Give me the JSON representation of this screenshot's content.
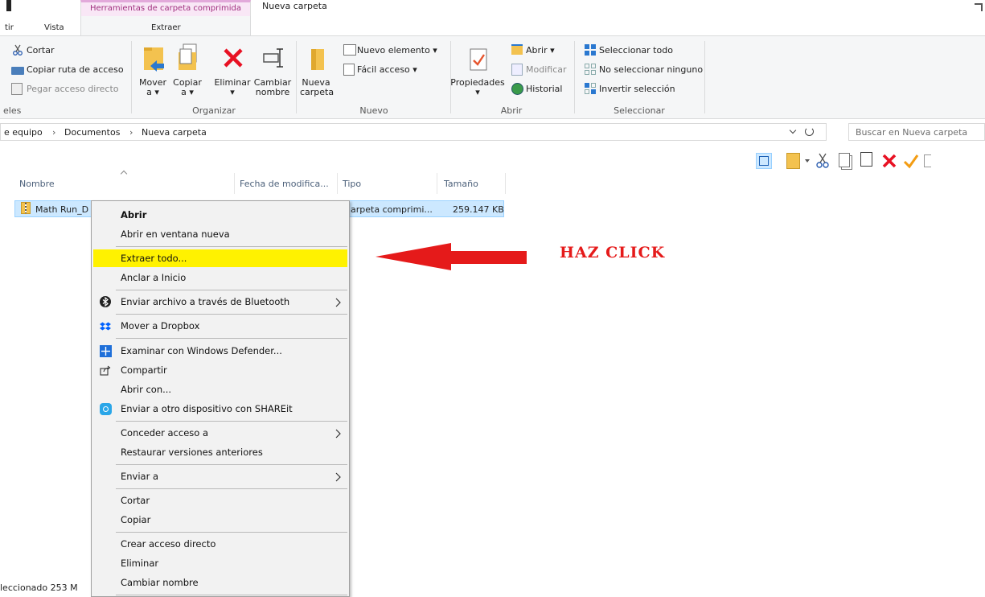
{
  "window": {
    "context_tab": "Herramientas de carpeta comprimida",
    "title": "Nueva carpeta"
  },
  "tabs": {
    "left_partial": "tir",
    "vista": "Vista",
    "extraer": "Extraer"
  },
  "ribbon": {
    "portapapeles": {
      "cortar": "Cortar",
      "copiar_ruta": "Copiar ruta de acceso",
      "pegar_acceso": "Pegar acceso directo",
      "group_partial": "eles"
    },
    "organizar": {
      "mover": [
        "Mover",
        "a ▾"
      ],
      "copiar": [
        "Copiar",
        "a ▾"
      ],
      "eliminar": [
        "Eliminar",
        "▾"
      ],
      "cambiar": [
        "Cambiar",
        "nombre"
      ],
      "group": "Organizar"
    },
    "nuevo": {
      "nueva_carpeta": [
        "Nueva",
        "carpeta"
      ],
      "nuevo_elemento": "Nuevo elemento ▾",
      "facil_acceso": "Fácil acceso ▾",
      "group": "Nuevo"
    },
    "abrir": {
      "propiedades": [
        "Propiedades",
        "▾"
      ],
      "abrir": "Abrir ▾",
      "modificar": "Modificar",
      "historial": "Historial",
      "group": "Abrir"
    },
    "seleccionar": {
      "todo": "Seleccionar todo",
      "ninguno": "No seleccionar ninguno",
      "invertir": "Invertir selección",
      "group": "Seleccionar"
    }
  },
  "address": {
    "crumbs": [
      "e equipo",
      "›",
      "Documentos",
      "›",
      "Nueva carpeta"
    ],
    "search_placeholder": "Buscar en Nueva carpeta"
  },
  "columns": [
    "Nombre",
    "Fecha de modifica...",
    "Tipo",
    "Tamaño"
  ],
  "file": {
    "name": "Math Run_D",
    "type": "arpeta comprimi...",
    "size": "259.147 KB"
  },
  "context_menu": {
    "abrir": "Abrir",
    "abrir_ventana": "Abrir en ventana nueva",
    "extraer_todo": "Extraer todo...",
    "anclar": "Anclar a Inicio",
    "bluetooth": "Enviar archivo a través de Bluetooth",
    "dropbox": "Mover a Dropbox",
    "defender": "Examinar con Windows Defender...",
    "compartir": "Compartir",
    "abrir_con": "Abrir con...",
    "shareit": "Enviar a otro dispositivo con SHAREit",
    "conceder": "Conceder acceso a",
    "restaurar": "Restaurar versiones anteriores",
    "enviar_a": "Enviar a",
    "cortar": "Cortar",
    "copiar": "Copiar",
    "crear_acceso": "Crear acceso directo",
    "eliminar": "Eliminar",
    "cambiar_nombre": "Cambiar nombre"
  },
  "status": "leccionado  253 M",
  "annotation": "HAZ CLICK",
  "colors": {
    "highlight": "#fff200",
    "arrow": "#e51a1a",
    "selection": "#cce8ff",
    "context_tab": "#f9e7f6"
  }
}
